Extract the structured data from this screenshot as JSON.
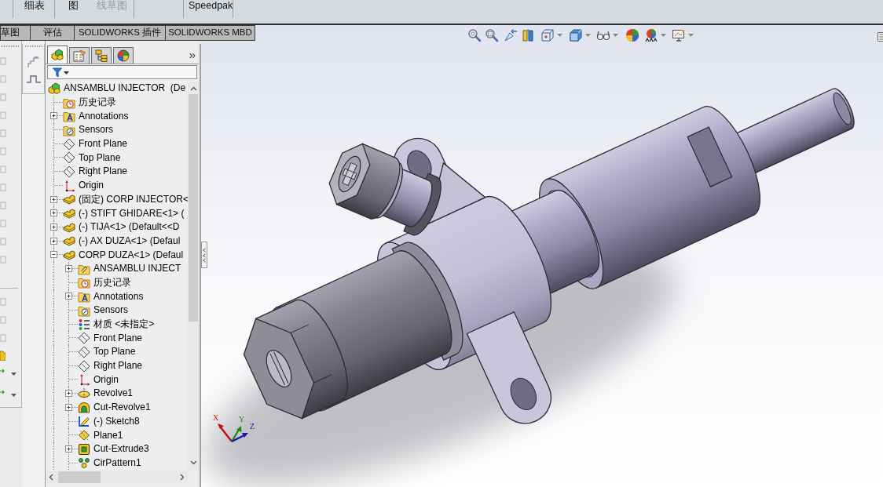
{
  "ribbon": {
    "groups": [
      {
        "buttons": [
          {
            "label": "细表",
            "disabled": false
          }
        ]
      },
      {
        "buttons": [
          {
            "label": "图",
            "disabled": false
          },
          {
            "label": "线草图",
            "disabled": true
          }
        ]
      },
      {
        "buttons": [
          {
            "label": "Speedpak",
            "disabled": false
          }
        ]
      }
    ]
  },
  "tabs": [
    {
      "label": "草图",
      "selected": false
    },
    {
      "label": "评估",
      "selected": false
    },
    {
      "label": "SOLIDWORKS 插件",
      "selected": false
    },
    {
      "label": "SOLIDWORKS MBD",
      "selected": false
    }
  ],
  "feature_manager": {
    "panel_tabs": [
      {
        "kind": "features",
        "selected": true
      },
      {
        "kind": "properties",
        "selected": false
      },
      {
        "kind": "configurations",
        "selected": false
      },
      {
        "kind": "display",
        "selected": false
      }
    ],
    "more": "»",
    "tree": {
      "kind": "assembly",
      "label": "ANSAMBLU INJECTOR  (De",
      "children": [
        {
          "kind": "history",
          "label": "历史记录"
        },
        {
          "kind": "annotations",
          "label": "Annotations",
          "expanded": false
        },
        {
          "kind": "sensors",
          "label": "Sensors"
        },
        {
          "kind": "plane",
          "label": "Front Plane"
        },
        {
          "kind": "plane",
          "label": "Top Plane"
        },
        {
          "kind": "plane",
          "label": "Right Plane"
        },
        {
          "kind": "origin",
          "label": "Origin"
        },
        {
          "kind": "part",
          "label": "(固定) CORP INJECTOR<",
          "expanded": false
        },
        {
          "kind": "part",
          "label": "(-) STIFT GHIDARE<1> (",
          "expanded": false
        },
        {
          "kind": "part",
          "label": "(-) TIJA<1> (Default<<D",
          "expanded": false
        },
        {
          "kind": "part",
          "label": "(-) AX DUZA<1> (Defaul",
          "expanded": false
        },
        {
          "kind": "part",
          "label": "CORP DUZA<1> (Defaul",
          "expanded": true,
          "children": [
            {
              "kind": "subassembly",
              "label": "ANSAMBLU INJECT",
              "expanded": false
            },
            {
              "kind": "history",
              "label": "历史记录"
            },
            {
              "kind": "annotations",
              "label": "Annotations",
              "expanded": false
            },
            {
              "kind": "sensors",
              "label": "Sensors"
            },
            {
              "kind": "material",
              "label": "材质 <未指定>"
            },
            {
              "kind": "plane",
              "label": "Front Plane"
            },
            {
              "kind": "plane",
              "label": "Top Plane"
            },
            {
              "kind": "plane",
              "label": "Right Plane"
            },
            {
              "kind": "origin",
              "label": "Origin"
            },
            {
              "kind": "revolve",
              "label": "Revolve1",
              "expanded": false
            },
            {
              "kind": "cutrevolve",
              "label": "Cut-Revolve1",
              "expanded": false
            },
            {
              "kind": "sketch",
              "label": "(-) Sketch8"
            },
            {
              "kind": "refplane",
              "label": "Plane1"
            },
            {
              "kind": "cutextrude",
              "label": "Cut-Extrude3",
              "expanded": false
            },
            {
              "kind": "pattern",
              "label": "CirPattern1"
            }
          ]
        }
      ]
    }
  },
  "triad": {
    "x_label": "X",
    "y_label": "Y",
    "z_label": "Z"
  }
}
